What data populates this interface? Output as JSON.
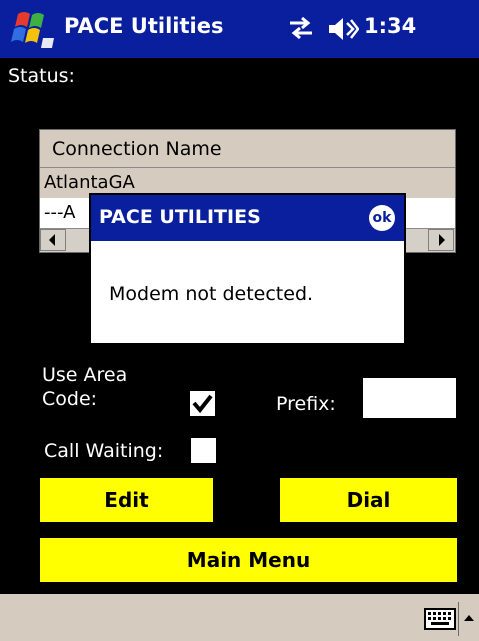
{
  "title_bar": {
    "app_title": "PACE Utilities",
    "clock": "1:34"
  },
  "status_label": "Status:",
  "connections": {
    "column_header": "Connection Name",
    "rows": [
      "AtlantaGA",
      "---A"
    ]
  },
  "dialog": {
    "title": "PACE UTILITIES",
    "ok_label": "ok",
    "message": "Modem not detected."
  },
  "form": {
    "use_area_code_label_line1": "Use Area",
    "use_area_code_label_line2": "Code:",
    "use_area_code_checked": true,
    "prefix_label": "Prefix:",
    "prefix_value": "",
    "call_waiting_label": "Call Waiting:",
    "call_waiting_checked": false
  },
  "buttons": {
    "edit": "Edit",
    "dial": "Dial",
    "main_menu": "Main Menu"
  },
  "colors": {
    "title_blue": "#0a1f9e",
    "button_yellow": "#ffff00",
    "header_tan": "#d6cbbf"
  }
}
